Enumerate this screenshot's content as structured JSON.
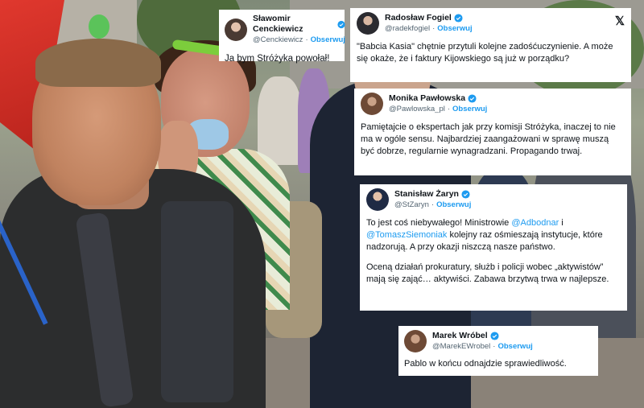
{
  "colors": {
    "verified": "#1d9bf0",
    "follow": "#1d9bf0",
    "text": "#0f1419",
    "handle": "#536471"
  },
  "tweets": [
    {
      "name": "Sławomir Cenckiewicz",
      "handle": "@Cenckiewicz",
      "follow": "Obserwuj",
      "text": "Ja bym Stróżyka powołał!"
    },
    {
      "name": "Radosław Fogiel",
      "handle": "@radekfogiel",
      "follow": "Obserwuj",
      "brand_icon": "x-logo-icon",
      "text": "\"Babcia Kasia\" chętnie przytuli kolejne zadośćuczynienie. A może się okaże, że i faktury Kijowskiego są już w porządku?"
    },
    {
      "name": "Monika Pawłowska",
      "handle": "@Pawlowska_pl",
      "follow": "Obserwuj",
      "text": "Pamiętajcie o ekspertach jak przy komisji Stróżyka, inaczej to nie ma w ogóle sensu. Najbardziej zaangażowani w sprawę muszą być dobrze, regularnie wynagradzani. Propagando trwaj."
    },
    {
      "name": "Stanisław Żaryn",
      "handle": "@StZaryn",
      "follow": "Obserwuj",
      "text_parts": [
        "To jest coś niebywałego! Ministrowie ",
        "@Adbodnar",
        " i ",
        "@TomaszSiemoniak",
        " kolejny raz ośmieszają instytucje, które nadzorują. A przy okazji niszczą nasze państwo."
      ],
      "text2": "Oceną działań prokuratury, służb i policji wobec „aktywistów” mają się zająć… aktywiści. Zabawa brzytwą trwa w najlepsze."
    },
    {
      "name": "Marek Wróbel",
      "handle": "@MarekEWrobel",
      "follow": "Obserwuj",
      "text": "Pablo w końcu odnajdzie sprawiedliwość."
    }
  ]
}
